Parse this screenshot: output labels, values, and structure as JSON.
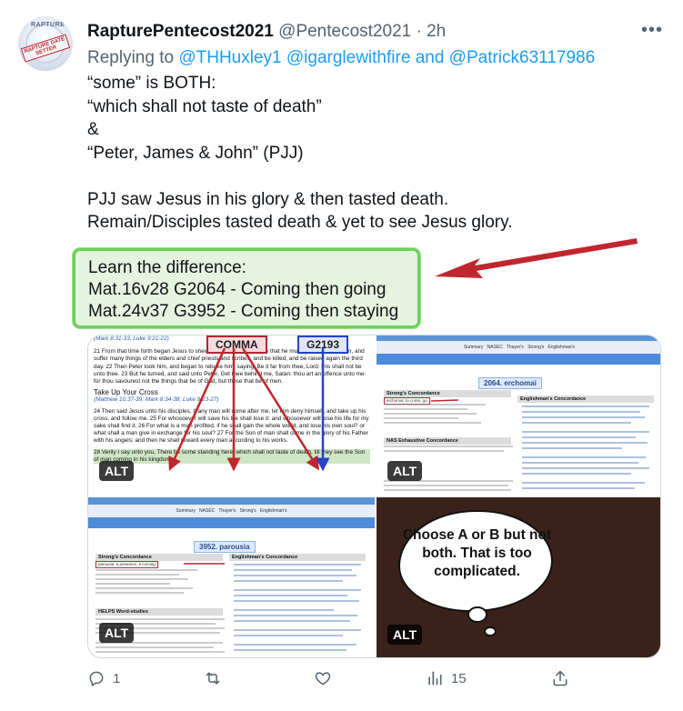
{
  "tweet": {
    "display_name": "RapturePentecost2021",
    "handle": "@Pentecost2021",
    "time": "2h",
    "more_label": "•••",
    "replying_prefix": "Replying to",
    "mentions": [
      "@THHuxley1",
      "@igarglewithfire",
      "@Patrick63117986"
    ],
    "mention_conjunction": "and",
    "lines": [
      "“some” is BOTH:",
      "“which shall not taste of death”",
      "&",
      "“Peter, James & John” (PJJ)",
      "",
      "PJJ saw Jesus in his glory & then tasted death.",
      "Remain/Disciples tasted death & yet to see Jesus glory."
    ],
    "callout_lines": [
      "Learn the difference:",
      "Mat.16v28 G2064 - Coming then going",
      "Mat.24v37 G3952 - Coming then staying"
    ],
    "avatar_text": {
      "top": "RAPTURE",
      "stamp": "RAPTURE DATE SETTER"
    },
    "arrow_color": "#c0262d"
  },
  "media": {
    "alt_label": "ALT",
    "panel1": {
      "tag_comma": "COMMA",
      "tag_g2193": "G2193",
      "ref_top": "(Mark 8:31-33; Luke 9:21-22)",
      "para1": "21 From that time forth began Jesus to shew unto his disciples, how that he must go unto Jerusalem, and suffer many things of the elders and chief priests and scribes, and be killed, and be raised again the third day. 22 Then Peter took him, and began to rebuke him, saying, Be it far from thee, Lord: this shall not be unto thee. 23 But he turned, and said unto Peter, Get thee behind me, Satan: thou art an offence unto me: for thou savourest not the things that be of God, but those that be of men.",
      "heading": "Take Up Your Cross",
      "ref_mid": "(Matthew 10:37-39; Mark 8:34-38; Luke 9:23-27)",
      "para2": "24 Then said Jesus unto his disciples, If any man will come after me, let him deny himself, and take up his cross, and follow me. 25 For whosoever will save his life shall lose it: and whosoever will lose his life for my sake shall find it. 26 For what is a man profited, if he shall gain the whole world, and lose his own soul? or what shall a man give in exchange for his soul? 27 For the Son of man shall come in the glory of his Father with his angels; and then he shall reward every man according to his works.",
      "para3": "28 Verily I say unto you, There be some standing here, which shall not taste of death, till they see the Son of man coming in his kingdom."
    },
    "panel2": {
      "nav": [
        "Summary",
        "NASEC",
        "Thayer's",
        "Strong's",
        "Englishman's"
      ],
      "word_title": "2064. erchomai",
      "strongs_heading": "Strong's Concordance",
      "strongs_word": "erchomai: to come, go",
      "englishmans_heading": "Englishman's Concordance",
      "nas_heading": "NAS Exhaustive Concordance"
    },
    "panel3": {
      "nav": [
        "Summary",
        "NASEC",
        "Thayer's",
        "Strong's",
        "Englishman's"
      ],
      "word_title": "3952. parousia",
      "strongs_heading": "Strong's Concordance",
      "strongs_word": "parousia: a presence, a coming",
      "englishmans_heading": "Englishman's Concordance",
      "helps_heading": "HELPS Word-studies"
    },
    "panel4": {
      "cartoon_text": "Choose A or B but not both. That is too complicated."
    }
  },
  "actions": {
    "reply_count": "1",
    "retweet_count": "",
    "like_count": "",
    "views_count": "15"
  }
}
